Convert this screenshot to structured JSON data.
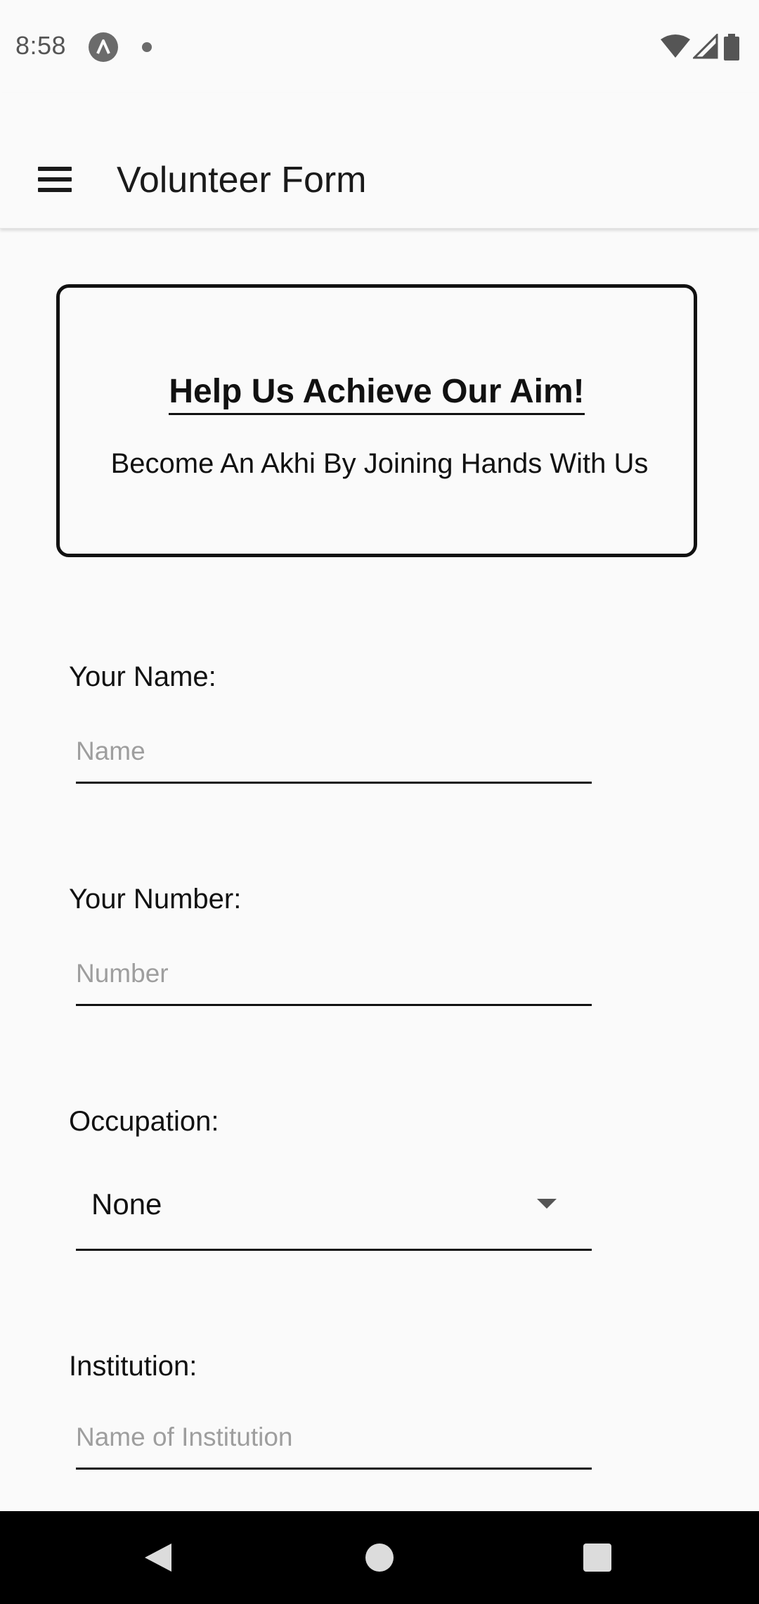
{
  "status_bar": {
    "time": "8:58"
  },
  "app_bar": {
    "title": "Volunteer Form"
  },
  "hero": {
    "title": "Help Us Achieve Our Aim!",
    "subtitle": "Become An Akhi By Joining Hands With Us"
  },
  "form": {
    "name": {
      "label": "Your Name:",
      "placeholder": "Name",
      "value": ""
    },
    "number": {
      "label": "Your Number:",
      "placeholder": "Number",
      "value": ""
    },
    "occupation": {
      "label": "Occupation:",
      "selected": "None"
    },
    "institution": {
      "label": "Institution:",
      "placeholder": "Name of Institution",
      "value": ""
    }
  },
  "icons": {
    "menu": "hamburger-menu-icon",
    "status_app": "app-notification-icon",
    "wifi": "wifi-icon",
    "signal": "cell-signal-icon",
    "battery": "battery-icon",
    "dropdown": "caret-down-icon",
    "nav_back": "back-triangle-icon",
    "nav_home": "home-circle-icon",
    "nav_recents": "recents-square-icon"
  },
  "colors": {
    "background": "#fafafa",
    "text": "#111111",
    "placeholder": "#9e9e9e",
    "nav_bar": "#000000"
  }
}
